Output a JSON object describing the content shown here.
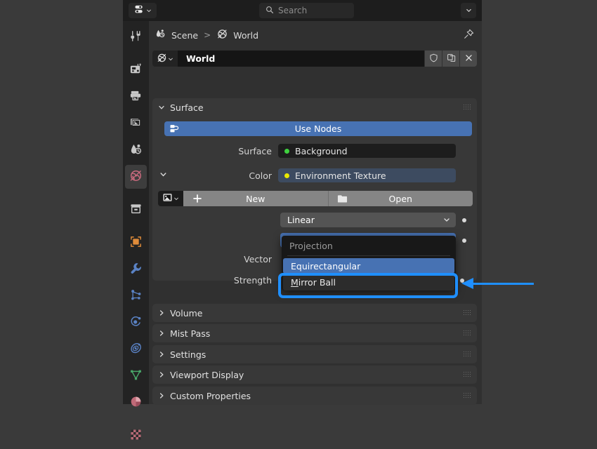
{
  "app": {
    "editor": "Properties",
    "background_color": "#3a3a3a"
  },
  "topbar": {
    "editor_type_icon": "properties-editor-icon",
    "editor_type_chevron": "chevron-down-icon",
    "search": {
      "placeholder": "Search",
      "value": "",
      "icon": "search-icon"
    },
    "options_chevron": "chevron-down-icon"
  },
  "tabs": [
    {
      "name": "tool",
      "icon": "tool-icon",
      "active": false
    },
    {
      "name": "render",
      "icon": "camera-back-icon",
      "active": false
    },
    {
      "name": "output",
      "icon": "printer-icon",
      "active": false
    },
    {
      "name": "view-layer",
      "icon": "images-icon",
      "active": false
    },
    {
      "name": "scene",
      "icon": "scene-cone-icon",
      "active": false
    },
    {
      "name": "world",
      "icon": "world-globe-icon",
      "active": true
    },
    {
      "name": "collection",
      "icon": "collection-box-icon",
      "active": false
    },
    {
      "name": "object",
      "icon": "object-square-icon",
      "active": false
    },
    {
      "name": "modifiers",
      "icon": "wrench-icon",
      "active": false
    },
    {
      "name": "particles",
      "icon": "particles-icon",
      "active": false
    },
    {
      "name": "physics",
      "icon": "physics-orbit-icon",
      "active": false
    },
    {
      "name": "object-constraints",
      "icon": "constraint-icon",
      "active": false
    },
    {
      "name": "object-data",
      "icon": "mesh-data-triangle-icon",
      "active": false
    },
    {
      "name": "material",
      "icon": "material-sphere-icon",
      "active": false
    },
    {
      "name": "texture",
      "icon": "texture-checker-icon",
      "active": false
    }
  ],
  "breadcrumb": {
    "items": [
      {
        "label": "Scene",
        "icon": "scene-icon"
      },
      {
        "label": "World",
        "icon": "world-globe-icon"
      }
    ],
    "separator": ">",
    "pin_icon": "pin-icon"
  },
  "datablock": {
    "browse_icon": "world-globe-icon",
    "browse_chevron": "chevron-down-icon",
    "name": "World",
    "buttons": [
      {
        "name": "fake-user",
        "icon": "shield-icon"
      },
      {
        "name": "new-copy",
        "icon": "copy-icon"
      },
      {
        "name": "unlink",
        "icon": "x-icon"
      }
    ]
  },
  "surface_panel": {
    "title": "Surface",
    "expanded": true,
    "use_nodes": {
      "label": "Use Nodes",
      "icon": "nodetree-icon",
      "color": "#4772b3"
    },
    "rows": [
      {
        "label": "Surface",
        "value": "Background",
        "dot_color": "#3fd13f",
        "field_color": "#1d1d1d",
        "has_expand": false
      },
      {
        "label": "Color",
        "value": "Environment Texture",
        "dot_color": "#e8e800",
        "field_color": "#3d4b60",
        "has_expand": true
      }
    ],
    "image_row": {
      "browse_icon": "image-data-icon",
      "browse_chevron": "chevron-down-icon",
      "new_label": "New",
      "new_icon": "plus-icon",
      "open_label": "Open",
      "open_icon": "folder-icon"
    },
    "interpolation": {
      "value": "Linear",
      "chevron": "chevron-down-icon"
    },
    "projection": {
      "value": "Equirectangular",
      "chevron": "chevron-down-icon",
      "active_color": "#4772b3"
    },
    "vector_label": "Vector",
    "strength_label": "Strength",
    "decorators": 4
  },
  "projection_menu": {
    "title": "Projection",
    "items": [
      {
        "label": "Equirectangular",
        "accelerator": "E",
        "selected": true
      },
      {
        "label": "Mirror Ball",
        "accelerator": "M",
        "selected": false,
        "hovered": true
      }
    ]
  },
  "panels": [
    {
      "title": "Volume",
      "expanded": false
    },
    {
      "title": "Mist Pass",
      "expanded": false
    },
    {
      "title": "Settings",
      "expanded": false
    },
    {
      "title": "Viewport Display",
      "expanded": false
    },
    {
      "title": "Custom Properties",
      "expanded": false
    }
  ],
  "annotation": {
    "highlight_color": "#1f8fff",
    "target": "Mirror Ball",
    "arrow_direction": "left"
  }
}
